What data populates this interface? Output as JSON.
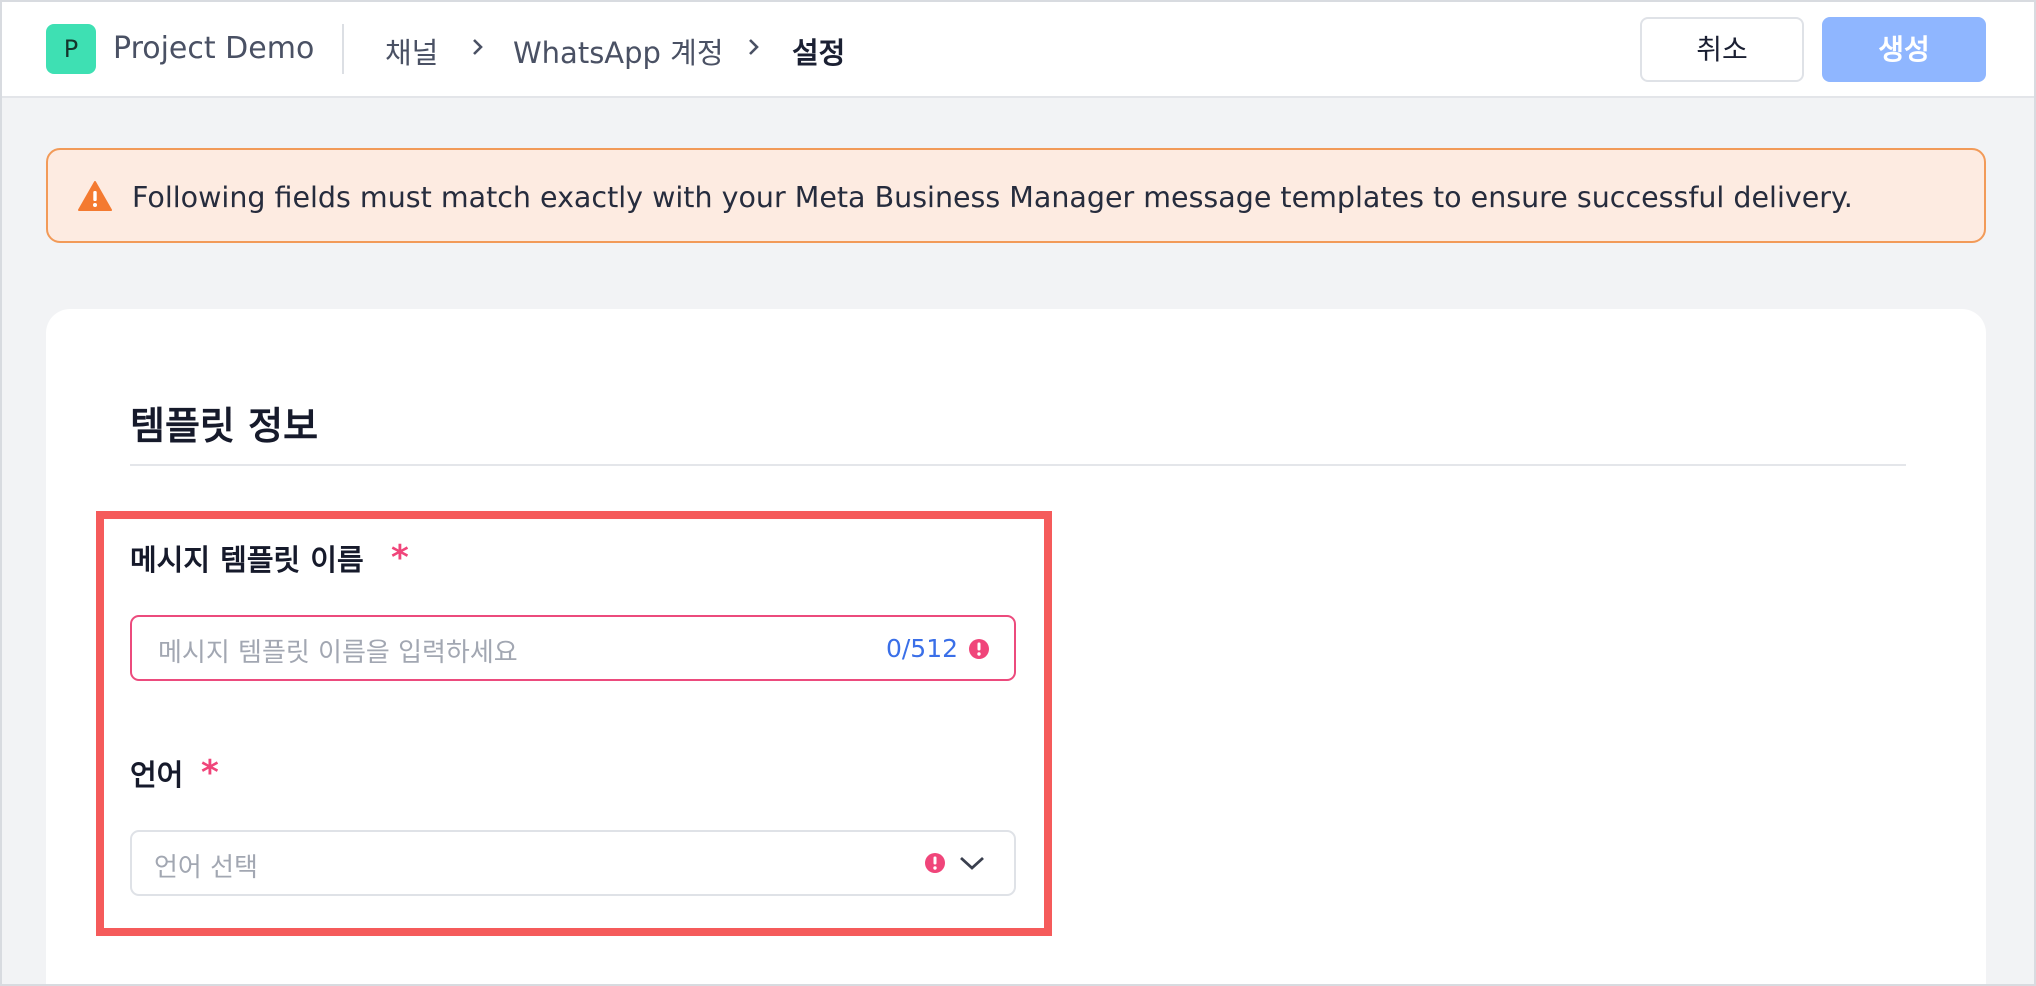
{
  "header": {
    "avatar_letter": "P",
    "project_name": "Project Demo",
    "breadcrumb": [
      "채널",
      "WhatsApp 계정",
      "설정"
    ],
    "cancel_label": "취소",
    "create_label": "생성"
  },
  "alert": {
    "icon": "warning-triangle-icon",
    "message": "Following fields must match exactly with your Meta Business Manager message templates to ensure successful delivery."
  },
  "form": {
    "section_title": "템플릿 정보",
    "template_name": {
      "label": "메시지 템플릿 이름",
      "required_mark": "*",
      "placeholder": "메시지 템플릿 이름을 입력하세요",
      "value": "",
      "counter": "0/512"
    },
    "language": {
      "label": "언어",
      "required_mark": "*",
      "placeholder": "언어 선택",
      "value": ""
    }
  },
  "colors": {
    "accent": "#3a6fe8",
    "create_button": "#8fb6ff",
    "error": "#f0457a",
    "warning": "#f47a30",
    "highlight": "#f55b5b",
    "avatar": "#3ee0b3"
  }
}
